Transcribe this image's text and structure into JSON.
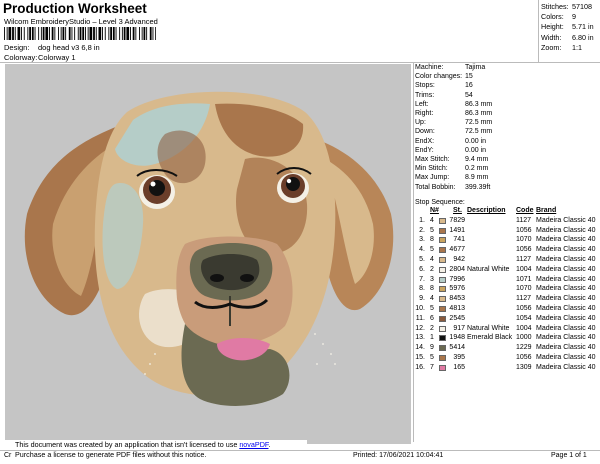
{
  "header": {
    "title": "Production Worksheet",
    "subtitle": "Wilcom EmbroideryStudio – Level 3 Advanced",
    "design_label": "Design:",
    "design_value": "dog head v3 6,8 in",
    "colorway_label": "Colorway:",
    "colorway_value": "Colorway 1"
  },
  "summary": [
    {
      "label": "Stitches:",
      "value": "57108"
    },
    {
      "label": "Colors:",
      "value": "9"
    },
    {
      "label": "Height:",
      "value": "5.71 in"
    },
    {
      "label": "Width:",
      "value": "6.80 in"
    },
    {
      "label": "Zoom:",
      "value": "1:1"
    }
  ],
  "machine_info": [
    {
      "label": "Machine:",
      "value": "Tajima"
    },
    {
      "label": "Color changes:",
      "value": "15"
    },
    {
      "label": "Stops:",
      "value": "16"
    },
    {
      "label": "Trims:",
      "value": "54"
    },
    {
      "label": "Left:",
      "value": "86.3 mm"
    },
    {
      "label": "Right:",
      "value": "86.3 mm"
    },
    {
      "label": "Up:",
      "value": "72.5 mm"
    },
    {
      "label": "Down:",
      "value": "72.5 mm"
    },
    {
      "label": "EndX:",
      "value": "0.00 in"
    },
    {
      "label": "EndY:",
      "value": "0.00 in"
    },
    {
      "label": "Max Stitch:",
      "value": "9.4 mm"
    },
    {
      "label": "Min Stitch:",
      "value": "0.2 mm"
    },
    {
      "label": "Max Jump:",
      "value": "8.9 mm"
    },
    {
      "label": "Total Bobbin:",
      "value": "399.39ft"
    }
  ],
  "stop_sequence": {
    "heading": "Stop Sequence:",
    "columns": [
      "N#",
      "St.",
      "Description",
      "Code",
      "Brand"
    ],
    "rows": [
      {
        "stop": "1.",
        "n": "4",
        "color": "#d8b98c",
        "st": "7829",
        "desc": "",
        "code": "1127",
        "brand": "Madeira Classic 40"
      },
      {
        "stop": "2.",
        "n": "5",
        "color": "#a9764c",
        "st": "1491",
        "desc": "",
        "code": "1056",
        "brand": "Madeira Classic 40"
      },
      {
        "stop": "3.",
        "n": "8",
        "color": "#c9a45f",
        "st": "741",
        "desc": "",
        "code": "1070",
        "brand": "Madeira Classic 40"
      },
      {
        "stop": "4.",
        "n": "5",
        "color": "#a9764c",
        "st": "4677",
        "desc": "",
        "code": "1056",
        "brand": "Madeira Classic 40"
      },
      {
        "stop": "5.",
        "n": "4",
        "color": "#d8b98c",
        "st": "942",
        "desc": "",
        "code": "1127",
        "brand": "Madeira Classic 40"
      },
      {
        "stop": "6.",
        "n": "2",
        "color": "#f4f0e6",
        "st": "2804",
        "desc": "Natural White",
        "code": "1004",
        "brand": "Madeira Classic 40"
      },
      {
        "stop": "7.",
        "n": "3",
        "color": "#b5cdc8",
        "st": "7996",
        "desc": "",
        "code": "1071",
        "brand": "Madeira Classic 40"
      },
      {
        "stop": "8.",
        "n": "8",
        "color": "#c9a45f",
        "st": "5976",
        "desc": "",
        "code": "1070",
        "brand": "Madeira Classic 40"
      },
      {
        "stop": "9.",
        "n": "4",
        "color": "#d8b98c",
        "st": "8453",
        "desc": "",
        "code": "1127",
        "brand": "Madeira Classic 40"
      },
      {
        "stop": "10.",
        "n": "5",
        "color": "#a9764c",
        "st": "4813",
        "desc": "",
        "code": "1056",
        "brand": "Madeira Classic 40"
      },
      {
        "stop": "11.",
        "n": "6",
        "color": "#8a5a3c",
        "st": "2545",
        "desc": "",
        "code": "1054",
        "brand": "Madeira Classic 40"
      },
      {
        "stop": "12.",
        "n": "2",
        "color": "#f4f0e6",
        "st": "917",
        "desc": "Natural White",
        "code": "1004",
        "brand": "Madeira Classic 40"
      },
      {
        "stop": "13.",
        "n": "1",
        "color": "#111111",
        "st": "1948",
        "desc": "Emerald Black",
        "code": "1000",
        "brand": "Madeira Classic 40"
      },
      {
        "stop": "14.",
        "n": "9",
        "color": "#6b6a52",
        "st": "5414",
        "desc": "",
        "code": "1229",
        "brand": "Madeira Classic 40"
      },
      {
        "stop": "15.",
        "n": "5",
        "color": "#a9764c",
        "st": "395",
        "desc": "",
        "code": "1056",
        "brand": "Madeira Classic 40"
      },
      {
        "stop": "16.",
        "n": "7",
        "color": "#e07aa4",
        "st": "165",
        "desc": "",
        "code": "1309",
        "brand": "Madeira Classic 40"
      }
    ]
  },
  "notice": {
    "line1_prefix": "This document was created by an application that isn't licensed to use ",
    "link_text": "novaPDF",
    "line1_suffix": ".",
    "line2": "Purchase a license to generate PDF files without this notice."
  },
  "footer": {
    "left": "Cr",
    "printed": "Printed: 17/06/2021 10:04:41",
    "page": "Page 1 of 1"
  }
}
